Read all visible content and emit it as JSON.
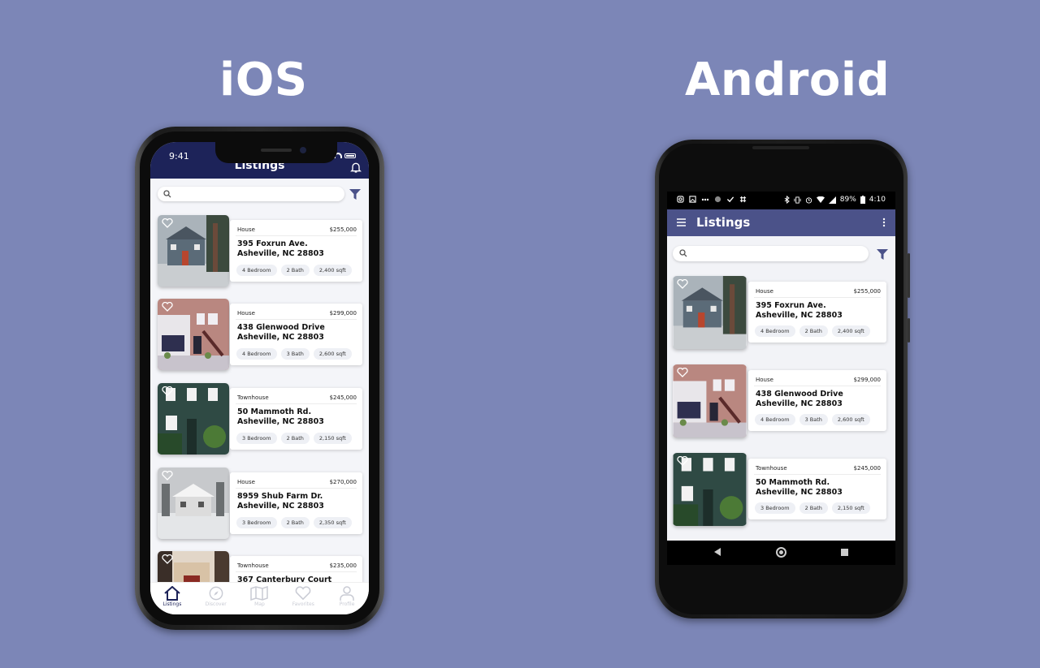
{
  "titles": {
    "ios": "iOS",
    "android": "Android"
  },
  "ios": {
    "time": "9:41",
    "header_title": "Listings",
    "tabs": [
      {
        "label": "Listings",
        "icon": "home-icon",
        "active": true
      },
      {
        "label": "Discover",
        "icon": "compass-icon",
        "active": false
      },
      {
        "label": "Map",
        "icon": "map-icon",
        "active": false
      },
      {
        "label": "Favorites",
        "icon": "heart-icon",
        "active": false
      },
      {
        "label": "Profile",
        "icon": "user-icon",
        "active": false
      }
    ]
  },
  "android": {
    "battery": "89%",
    "time": "4:10",
    "toolbar_title": "Listings"
  },
  "listings": [
    {
      "type": "House",
      "price": "$255,000",
      "street": "395 Foxrun Ave.",
      "city": "Asheville, NC 28803",
      "beds": "4 Bedroom",
      "baths": "2 Bath",
      "sqft": "2,400 sqft"
    },
    {
      "type": "House",
      "price": "$299,000",
      "street": "438 Glenwood Drive",
      "city": "Asheville, NC 28803",
      "beds": "4 Bedroom",
      "baths": "3 Bath",
      "sqft": "2,600 sqft"
    },
    {
      "type": "Townhouse",
      "price": "$245,000",
      "street": "50 Mammoth Rd.",
      "city": "Asheville, NC 28803",
      "beds": "3 Bedroom",
      "baths": "2 Bath",
      "sqft": "2,150 sqft"
    },
    {
      "type": "House",
      "price": "$270,000",
      "street": "8959 Shub Farm Dr.",
      "city": "Asheville, NC 28803",
      "beds": "3 Bedroom",
      "baths": "2 Bath",
      "sqft": "2,350 sqft"
    },
    {
      "type": "Townhouse",
      "price": "$235,000",
      "street": "367 Canterbury Court",
      "city": "",
      "beds": "",
      "baths": "",
      "sqft": ""
    }
  ],
  "colors": {
    "background": "#7c86b7",
    "ios_header": "#1d2359",
    "android_toolbar": "#4b5289",
    "accent": "#4b5289"
  }
}
